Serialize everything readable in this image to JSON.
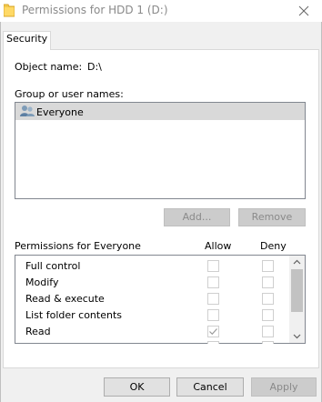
{
  "window": {
    "title": "Permissions for HDD 1 (D:)",
    "title_color": "#8a8a8a"
  },
  "tabs": [
    {
      "label": "Security",
      "selected": true
    }
  ],
  "object": {
    "label": "Object name:",
    "value": "D:\\"
  },
  "groups": {
    "label": "Group or user names:",
    "items": [
      {
        "name": "Everyone",
        "icon": "users-icon",
        "selected": true
      }
    ]
  },
  "group_buttons": {
    "add": "Add...",
    "remove": "Remove"
  },
  "permissions": {
    "label": "Permissions for Everyone",
    "allow_header": "Allow",
    "deny_header": "Deny",
    "rows": [
      {
        "name": "Full control",
        "allow": false,
        "deny": false
      },
      {
        "name": "Modify",
        "allow": false,
        "deny": false
      },
      {
        "name": "Read & execute",
        "allow": false,
        "deny": false
      },
      {
        "name": "List folder contents",
        "allow": false,
        "deny": false
      },
      {
        "name": "Read",
        "allow": true,
        "deny": false
      }
    ]
  },
  "dialog_buttons": {
    "ok": "OK",
    "cancel": "Cancel",
    "apply": "Apply"
  }
}
